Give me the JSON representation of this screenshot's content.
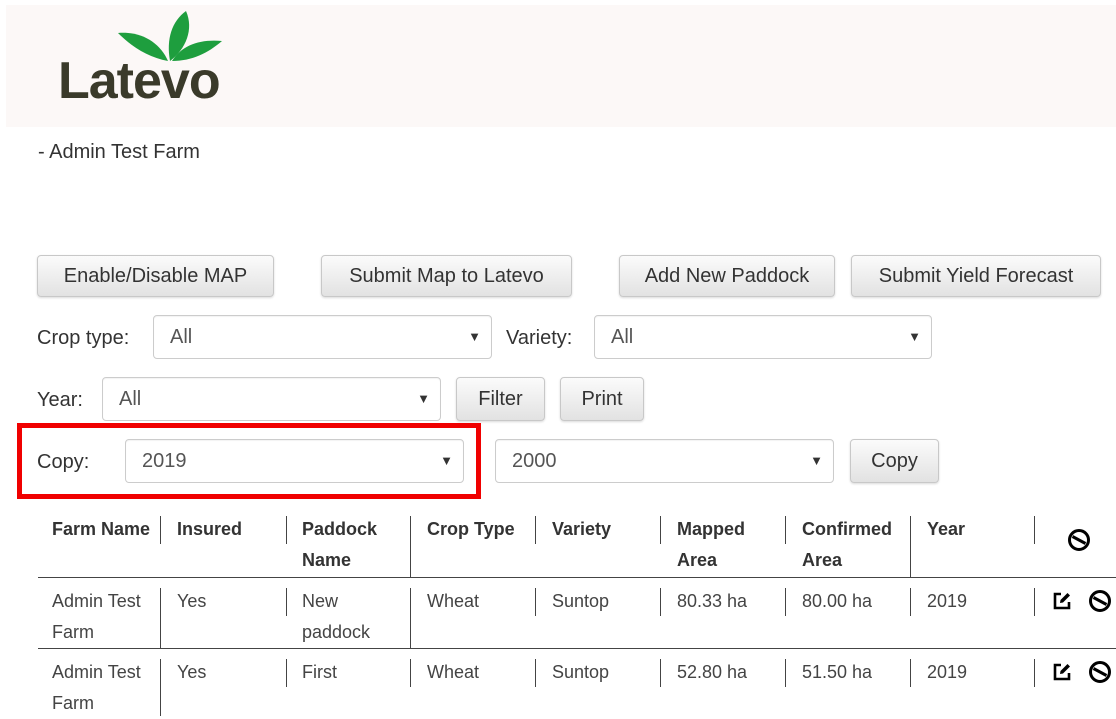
{
  "brand": {
    "name": "Latevo",
    "leaf_color": "#1e9e3e",
    "text_color": "#3a3a2a"
  },
  "farm_title": "- Admin Test Farm",
  "toolbar": {
    "enable_map": "Enable/Disable MAP",
    "submit_map": "Submit Map to Latevo",
    "add_paddock": "Add New Paddock",
    "submit_yield": "Submit Yield Forecast"
  },
  "filters": {
    "crop_type_label": "Crop type:",
    "crop_type_value": "All",
    "variety_label": "Variety:",
    "variety_value": "All",
    "year_label": "Year:",
    "year_value": "All",
    "filter_button": "Filter",
    "print_button": "Print"
  },
  "copy": {
    "label": "Copy:",
    "from_year": "2019",
    "to_year": "2000",
    "button": "Copy",
    "highlight_color": "#f00000"
  },
  "table": {
    "headers": {
      "farm_name": "Farm Name",
      "insured": "Insured",
      "paddock_name_1": "Paddock",
      "paddock_name_2": "Name",
      "crop_type": "Crop Type",
      "variety": "Variety",
      "mapped_area_1": "Mapped",
      "mapped_area_2": "Area",
      "confirmed_area_1": "Confirmed",
      "confirmed_area_2": "Area",
      "year": "Year"
    },
    "rows": [
      {
        "farm_1": "Admin Test",
        "farm_2": "Farm",
        "insured": "Yes",
        "paddock_1": "New",
        "paddock_2": "paddock",
        "crop": "Wheat",
        "variety": "Suntop",
        "mapped": "80.33 ha",
        "confirmed": "80.00 ha",
        "year": "2019"
      },
      {
        "farm_1": "Admin Test",
        "farm_2": "Farm",
        "insured": "Yes",
        "paddock_1": "First",
        "paddock_2": "",
        "crop": "Wheat",
        "variety": "Suntop",
        "mapped": "52.80 ha",
        "confirmed": "51.50 ha",
        "year": "2019"
      }
    ]
  },
  "icons": {
    "edit": "edit-icon",
    "disable": "ban-icon"
  }
}
